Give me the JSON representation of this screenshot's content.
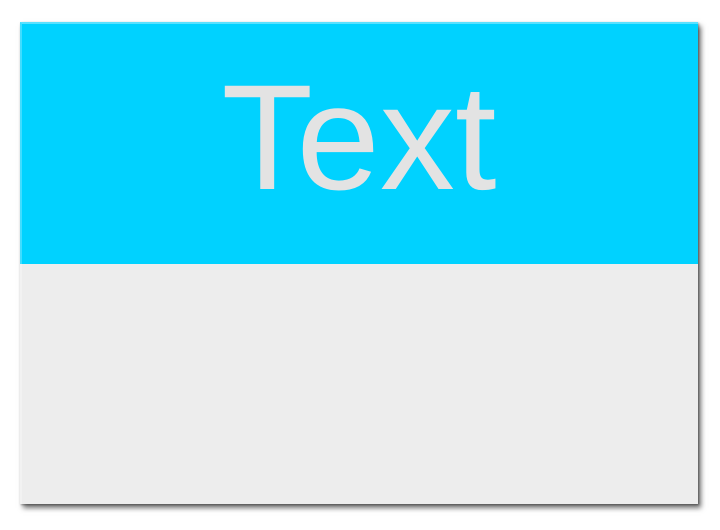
{
  "card": {
    "header_text": "Text"
  },
  "colors": {
    "header_background": "#00d2ff",
    "header_text": "#e3e3e3",
    "body_background": "#ededed"
  }
}
